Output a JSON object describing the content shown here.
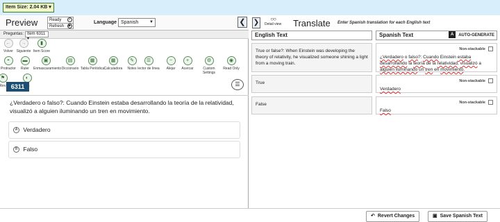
{
  "top": {
    "item_size": "Item Size: 2.04 KB ▾"
  },
  "preview": {
    "title": "Preview",
    "status": {
      "ready": "Ready",
      "refresh": "Refresh"
    },
    "language_label": "Language",
    "language_value": "Spanish",
    "preguntas_label": "Preguntas:",
    "preguntas_value": "Item 6311",
    "tools": [
      {
        "label": "Volver",
        "icon": "arrow-left-icon",
        "glyph": "←",
        "disabled": true
      },
      {
        "label": "Siguiente",
        "icon": "arrow-right-icon",
        "glyph": "→",
        "disabled": true
      },
      {
        "label": "Item Score",
        "icon": "score-icon",
        "glyph": "▮",
        "disabled": false
      },
      {
        "label": "Protractor",
        "icon": "protractor-icon",
        "glyph": "◓",
        "disabled": false
      },
      {
        "label": "Ruler",
        "icon": "ruler-icon",
        "glyph": "▬",
        "disabled": false
      },
      {
        "label": "Enmascaramiento",
        "icon": "mask-icon",
        "glyph": "▣",
        "disabled": false
      },
      {
        "label": "Diccionario",
        "icon": "dictionary-icon",
        "glyph": "▤",
        "disabled": false
      },
      {
        "label": "Tabla Periódica",
        "icon": "periodic-table-icon",
        "glyph": "▦",
        "disabled": false
      },
      {
        "label": "Calculadora",
        "icon": "calculator-icon",
        "glyph": "▦",
        "disabled": false
      },
      {
        "label": "Notes",
        "icon": "notes-icon",
        "glyph": "✎",
        "disabled": false
      },
      {
        "label": "lector de línea",
        "icon": "line-reader-icon",
        "glyph": "☰",
        "disabled": false
      },
      {
        "label": "Alejar",
        "icon": "zoom-out-icon",
        "glyph": "−",
        "disabled": false
      },
      {
        "label": "Acercar",
        "icon": "zoom-in-icon",
        "glyph": "+",
        "disabled": false
      },
      {
        "label": "Custom Settings",
        "icon": "settings-icon",
        "glyph": "⚙",
        "disabled": false
      },
      {
        "label": "Read Only",
        "icon": "read-only-icon",
        "glyph": "◉",
        "disabled": false
      },
      {
        "label": "Rev",
        "icon": "review-icon",
        "glyph": "⚑",
        "disabled": false
      },
      {
        "label": "res",
        "icon": "resources-icon",
        "glyph": "◐",
        "disabled": false
      }
    ],
    "item_badge": "6311",
    "question": "¿Verdadero o falso?: Cuando Einstein estaba desarrollando la teoría de la relatividad, visualizó a alguien iluminando un tren en movimiento.",
    "choices": [
      {
        "letter": "A",
        "text": "Verdadero"
      },
      {
        "letter": "B",
        "text": "Falso"
      }
    ]
  },
  "translate": {
    "detail_view": "Detail view",
    "title": "Translate",
    "hint": "Enter Spanish translation for each English text",
    "col_english": "English Text",
    "col_spanish": "Spanish Text",
    "auto_generate": "AUTO-GENERATE",
    "non_stackable": "Non-stackable",
    "rows": [
      {
        "english": "True or false?: When Einstein was developing the theory of relativity, he visualized someone shining a light from a moving train.",
        "spanish_parts": [
          {
            "t": "¿Verdadero",
            "s": true
          },
          {
            "t": " o ",
            "s": false
          },
          {
            "t": "falso",
            "s": true
          },
          {
            "t": "?: ",
            "s": false
          },
          {
            "t": "Cuando",
            "s": true
          },
          {
            "t": " Einstein ",
            "s": false
          },
          {
            "t": "estaba desarrollando",
            "s": true
          },
          {
            "t": " la ",
            "s": false
          },
          {
            "t": "teoría",
            "s": true
          },
          {
            "t": " de la ",
            "s": false
          },
          {
            "t": "relatividad",
            "s": true
          },
          {
            "t": ", ",
            "s": false
          },
          {
            "t": "visualizó",
            "s": true
          },
          {
            "t": " a ",
            "s": false
          },
          {
            "t": "alguien iluminando",
            "s": true
          },
          {
            "t": " un ",
            "s": false
          },
          {
            "t": "tren",
            "s": true
          },
          {
            "t": " en ",
            "s": false
          },
          {
            "t": "movimiento",
            "s": true
          },
          {
            "t": ".",
            "s": false
          }
        ]
      },
      {
        "english": "True",
        "spanish_parts": [
          {
            "t": "Verdadero",
            "s": true
          }
        ]
      },
      {
        "english": "False",
        "spanish_parts": [
          {
            "t": "Falso",
            "s": true
          }
        ]
      }
    ]
  },
  "footer": {
    "revert": "Revert Changes",
    "save": "Save Spanish Text"
  }
}
